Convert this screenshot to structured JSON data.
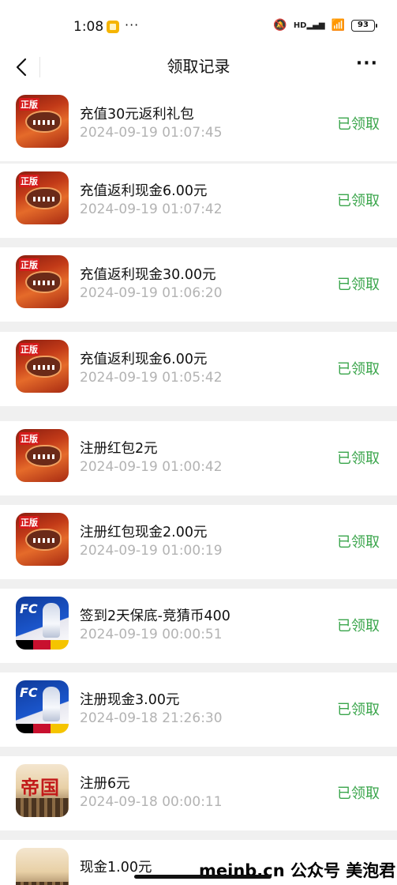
{
  "status_bar": {
    "time": "1:08",
    "more": "···",
    "signal": "HD",
    "battery": "93"
  },
  "nav": {
    "title": "领取记录",
    "more": "···"
  },
  "records": [
    {
      "title": "充值30元返利礼包",
      "time": "2024-09-19 01:07:45",
      "status": "已领取",
      "game": "warship",
      "icon_text": "正版"
    },
    {
      "title": "充值返利现金6.00元",
      "time": "2024-09-19 01:07:42",
      "status": "已领取",
      "game": "warship",
      "icon_text": "正版"
    },
    {
      "title": "充值返利现金30.00元",
      "time": "2024-09-19 01:06:20",
      "status": "已领取",
      "game": "warship",
      "icon_text": "正版"
    },
    {
      "title": "充值返利现金6.00元",
      "time": "2024-09-19 01:05:42",
      "status": "已领取",
      "game": "warship",
      "icon_text": "正版"
    },
    {
      "title": "注册红包2元",
      "time": "2024-09-19 01:00:42",
      "status": "已领取",
      "game": "warship",
      "icon_text": "正版"
    },
    {
      "title": "注册红包现金2.00元",
      "time": "2024-09-19 01:00:19",
      "status": "已领取",
      "game": "warship",
      "icon_text": "正版"
    },
    {
      "title": "签到2天保底-竞猜币400",
      "time": "2024-09-19 00:00:51",
      "status": "已领取",
      "game": "fc",
      "icon_text": "FC"
    },
    {
      "title": "注册现金3.00元",
      "time": "2024-09-18 21:26:30",
      "status": "已领取",
      "game": "fc",
      "icon_text": "FC"
    },
    {
      "title": "注册6元",
      "time": "2024-09-18 00:00:11",
      "status": "已领取",
      "game": "empire",
      "icon_text": "帝国"
    },
    {
      "title": "现金1.00元",
      "time": "",
      "status": "",
      "game": "empire",
      "icon_text": ""
    }
  ],
  "watermark": "meinb.cn  公众号 美泡君",
  "colors": {
    "status_green": "#3aa54b",
    "timestamp_gray": "#b3b3b3",
    "separator": "#f0f0f0"
  }
}
